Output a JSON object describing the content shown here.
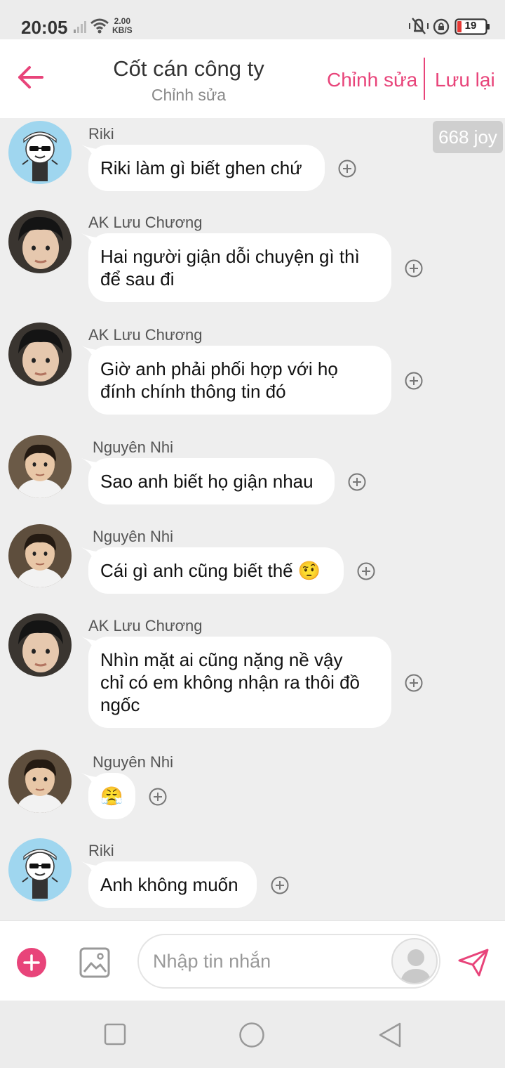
{
  "status_bar": {
    "time": "20:05",
    "speed_value": "2.00",
    "speed_unit": "KB/S",
    "battery": "19"
  },
  "header": {
    "title": "Cốt cán công ty",
    "subtitle": "Chỉnh sửa",
    "edit_label": "Chỉnh sửa",
    "save_label": "Lưu lại",
    "accent_color": "#e8447a"
  },
  "joy_badge": "668 joy",
  "messages": [
    {
      "sender": "Riki",
      "avatar": "cartoon-sunglasses-avatar",
      "lines": [
        "Riki làm gì biết ghen chứ"
      ]
    },
    {
      "sender": "AK Lưu Chương",
      "avatar": "boy-photo-avatar",
      "lines": [
        "Hai người giận dỗi chuyện gì thì",
        "để sau đi"
      ]
    },
    {
      "sender": "AK Lưu Chương",
      "avatar": "boy-photo-avatar",
      "lines": [
        "Giờ anh phải phối hợp với họ",
        "đính chính thông tin đó"
      ]
    },
    {
      "sender": "Nguyên Nhi",
      "avatar": "child-photo-avatar",
      "lines": [
        "Sao anh biết họ giận nhau"
      ]
    },
    {
      "sender": "Nguyên Nhi",
      "avatar": "child-photo-avatar",
      "lines": [
        "Cái gì anh cũng biết thế 🤨"
      ]
    },
    {
      "sender": "AK Lưu Chương",
      "avatar": "boy-photo-avatar",
      "lines": [
        "Nhìn mặt ai cũng nặng nề vậy",
        "chỉ có em không nhận ra thôi đồ",
        "ngốc"
      ]
    },
    {
      "sender": "Nguyên Nhi",
      "avatar": "child-photo-avatar",
      "lines": [
        "😤"
      ]
    },
    {
      "sender": "Riki",
      "avatar": "cartoon-sunglasses-avatar",
      "lines": [
        "Anh không muốn"
      ]
    }
  ],
  "input": {
    "placeholder": "Nhập tin nhắn"
  }
}
